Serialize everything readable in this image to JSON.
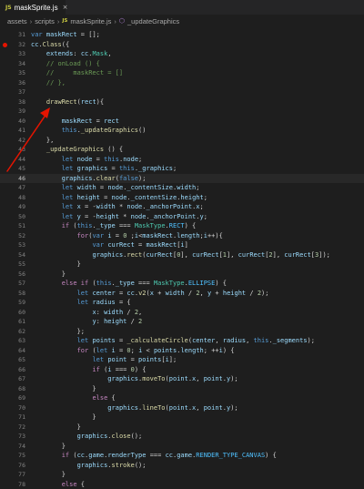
{
  "tab": {
    "icon": "JS",
    "title": "maskSprite.js",
    "close": "×"
  },
  "breadcrumb": {
    "parts": [
      "assets",
      "scripts"
    ],
    "file_icon": "JS",
    "file": "maskSprite.js",
    "method": "_updateGraphics"
  },
  "editor": {
    "current_line": 46,
    "breakpoint_line": 32,
    "lines": [
      {
        "n": 31,
        "html": "<span class='k'>var</span> <span class='v'>maskRect</span> = [];"
      },
      {
        "n": 32,
        "html": "<span class='v'>cc</span>.<span class='f'>Class</span>({"
      },
      {
        "n": 33,
        "html": "    <span class='v'>extends</span>: <span class='v'>cc</span>.<span class='t'>Mask</span>,"
      },
      {
        "n": 34,
        "html": "    <span class='c'>// onLoad () {</span>"
      },
      {
        "n": 35,
        "html": "    <span class='c'>//     maskRect = []</span>"
      },
      {
        "n": 36,
        "html": "    <span class='c'>// },</span>"
      },
      {
        "n": 37,
        "html": ""
      },
      {
        "n": 38,
        "html": "    <span class='f'>drawRect</span>(<span class='v'>rect</span>){"
      },
      {
        "n": 39,
        "html": ""
      },
      {
        "n": 40,
        "html": "        <span class='v'>maskRect</span> = <span class='v'>rect</span>"
      },
      {
        "n": 41,
        "html": "        <span class='k'>this</span>.<span class='f'>_updateGraphics</span>()"
      },
      {
        "n": 42,
        "html": "    },"
      },
      {
        "n": 43,
        "html": "    <span class='f'>_updateGraphics</span> () {"
      },
      {
        "n": 44,
        "html": "        <span class='k'>let</span> <span class='v'>node</span> = <span class='k'>this</span>.<span class='v'>node</span>;"
      },
      {
        "n": 45,
        "html": "        <span class='k'>let</span> <span class='v'>graphics</span> = <span class='k'>this</span>.<span class='v'>_graphics</span>;"
      },
      {
        "n": 46,
        "html": "        <span class='v'>graphics</span>.<span class='f'>clear</span>(<span class='k'>false</span>);"
      },
      {
        "n": 47,
        "html": "        <span class='k'>let</span> <span class='v'>width</span> = <span class='v'>node</span>.<span class='v'>_contentSize</span>.<span class='v'>width</span>;"
      },
      {
        "n": 48,
        "html": "        <span class='k'>let</span> <span class='v'>height</span> = <span class='v'>node</span>.<span class='v'>_contentSize</span>.<span class='v'>height</span>;"
      },
      {
        "n": 49,
        "html": "        <span class='k'>let</span> <span class='v'>x</span> = -<span class='v'>width</span> * <span class='v'>node</span>.<span class='v'>_anchorPoint</span>.<span class='v'>x</span>;"
      },
      {
        "n": 50,
        "html": "        <span class='k'>let</span> <span class='v'>y</span> = -<span class='v'>height</span> * <span class='v'>node</span>.<span class='v'>_anchorPoint</span>.<span class='v'>y</span>;"
      },
      {
        "n": 51,
        "html": "        <span class='ctl'>if</span> (<span class='k'>this</span>.<span class='v'>_type</span> === <span class='t'>MaskType</span>.<span class='cst'>RECT</span>) {"
      },
      {
        "n": 52,
        "html": "            <span class='ctl'>for</span>(<span class='k'>var</span> <span class='v'>i</span> = <span class='n'>0</span> ;<span class='v'>i</span>&lt;<span class='v'>maskRect</span>.<span class='v'>length</span>;<span class='v'>i</span>++){"
      },
      {
        "n": 53,
        "html": "                <span class='k'>var</span> <span class='v'>curRect</span> = <span class='v'>maskRect</span>[<span class='v'>i</span>]"
      },
      {
        "n": 54,
        "html": "                <span class='v'>graphics</span>.<span class='f'>rect</span>(<span class='v'>curRect</span>[<span class='n'>0</span>], <span class='v'>curRect</span>[<span class='n'>1</span>], <span class='v'>curRect</span>[<span class='n'>2</span>], <span class='v'>curRect</span>[<span class='n'>3</span>]);"
      },
      {
        "n": 55,
        "html": "            }"
      },
      {
        "n": 56,
        "html": "        }"
      },
      {
        "n": 57,
        "html": "        <span class='ctl'>else if</span> (<span class='k'>this</span>.<span class='v'>_type</span> === <span class='t'>MaskType</span>.<span class='cst'>ELLIPSE</span>) {"
      },
      {
        "n": 58,
        "html": "            <span class='k'>let</span> <span class='v'>center</span> = <span class='v'>cc</span>.<span class='f'>v2</span>(<span class='v'>x</span> + <span class='v'>width</span> / <span class='n'>2</span>, <span class='v'>y</span> + <span class='v'>height</span> / <span class='n'>2</span>);"
      },
      {
        "n": 59,
        "html": "            <span class='k'>let</span> <span class='v'>radius</span> = {"
      },
      {
        "n": 60,
        "html": "                <span class='v'>x</span>: <span class='v'>width</span> / <span class='n'>2</span>,"
      },
      {
        "n": 61,
        "html": "                <span class='v'>y</span>: <span class='v'>height</span> / <span class='n'>2</span>"
      },
      {
        "n": 62,
        "html": "            };"
      },
      {
        "n": 63,
        "html": "            <span class='k'>let</span> <span class='v'>points</span> = <span class='f'>_calculateCircle</span>(<span class='v'>center</span>, <span class='v'>radius</span>, <span class='k'>this</span>.<span class='v'>_segments</span>);"
      },
      {
        "n": 64,
        "html": "            <span class='ctl'>for</span> (<span class='k'>let</span> <span class='v'>i</span> = <span class='n'>0</span>; <span class='v'>i</span> &lt; <span class='v'>points</span>.<span class='v'>length</span>; ++<span class='v'>i</span>) {"
      },
      {
        "n": 65,
        "html": "                <span class='k'>let</span> <span class='v'>point</span> = <span class='v'>points</span>[<span class='v'>i</span>];"
      },
      {
        "n": 66,
        "html": "                <span class='ctl'>if</span> (<span class='v'>i</span> === <span class='n'>0</span>) {"
      },
      {
        "n": 67,
        "html": "                    <span class='v'>graphics</span>.<span class='f'>moveTo</span>(<span class='v'>point</span>.<span class='v'>x</span>, <span class='v'>point</span>.<span class='v'>y</span>);"
      },
      {
        "n": 68,
        "html": "                }"
      },
      {
        "n": 69,
        "html": "                <span class='ctl'>else</span> {"
      },
      {
        "n": 70,
        "html": "                    <span class='v'>graphics</span>.<span class='f'>lineTo</span>(<span class='v'>point</span>.<span class='v'>x</span>, <span class='v'>point</span>.<span class='v'>y</span>);"
      },
      {
        "n": 71,
        "html": "                }"
      },
      {
        "n": 72,
        "html": "            }"
      },
      {
        "n": 73,
        "html": "            <span class='v'>graphics</span>.<span class='f'>close</span>();"
      },
      {
        "n": 74,
        "html": "        }"
      },
      {
        "n": 75,
        "html": "        <span class='ctl'>if</span> (<span class='v'>cc</span>.<span class='v'>game</span>.<span class='v'>renderType</span> === <span class='v'>cc</span>.<span class='v'>game</span>.<span class='cst'>RENDER_TYPE_CANVAS</span>) {"
      },
      {
        "n": 76,
        "html": "            <span class='v'>graphics</span>.<span class='f'>stroke</span>();"
      },
      {
        "n": 77,
        "html": "        }"
      },
      {
        "n": 78,
        "html": "        <span class='ctl'>else</span> {"
      }
    ]
  },
  "annotation": {
    "color": "#e51400"
  }
}
